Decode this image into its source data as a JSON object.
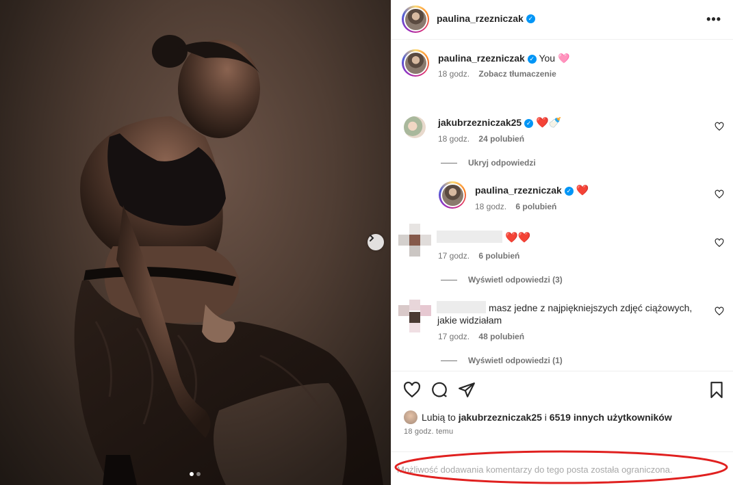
{
  "post": {
    "author": "paulina_rzezniczak",
    "caption_text": "You 🩷",
    "caption_time": "18 godz.",
    "translate_label": "Zobacz tłumaczenie",
    "carousel_dots": 2,
    "carousel_active": 1
  },
  "comments": [
    {
      "username": "jakubrzezniczak25",
      "verified": true,
      "text": "❤️🍼",
      "time": "18 godz.",
      "likes": "24 polubień",
      "replies_toggle": "Ukryj odpowiedzi"
    },
    {
      "username": "paulina_rzezniczak",
      "verified": true,
      "text": "❤️",
      "time": "18 godz.",
      "likes": "6 polubień",
      "is_reply": true
    },
    {
      "username": "",
      "text": "❤️❤️",
      "time": "17 godz.",
      "likes": "6 polubień",
      "replies_toggle": "Wyświetl odpowiedzi (3)"
    },
    {
      "username": "",
      "text_line1": "masz jedne z najpiękniejszych zdjęć ciążowych,",
      "text_line2": "jakie widziałam",
      "time": "17 godz.",
      "likes": "48 polubień",
      "replies_toggle": "Wyświetl odpowiedzi (1)"
    }
  ],
  "likes_summary": {
    "prefix": "Lubią to",
    "user": "jakubrzezniczak25",
    "middle": "i",
    "others": "6519 innych użytkowników"
  },
  "post_time": "18 godz. temu",
  "comments_restricted": "Możliwość dodawania komentarzy do tego posta została ograniczona.",
  "icons": {
    "header_more": "more-horizontal-icon",
    "like": "heart-icon",
    "comment": "comment-icon",
    "share": "send-icon",
    "save": "bookmark-icon",
    "next": "chevron-right-icon"
  },
  "colors": {
    "verified": "#0095f6",
    "muted_text": "#737373",
    "annotation_red": "#e0201f"
  }
}
